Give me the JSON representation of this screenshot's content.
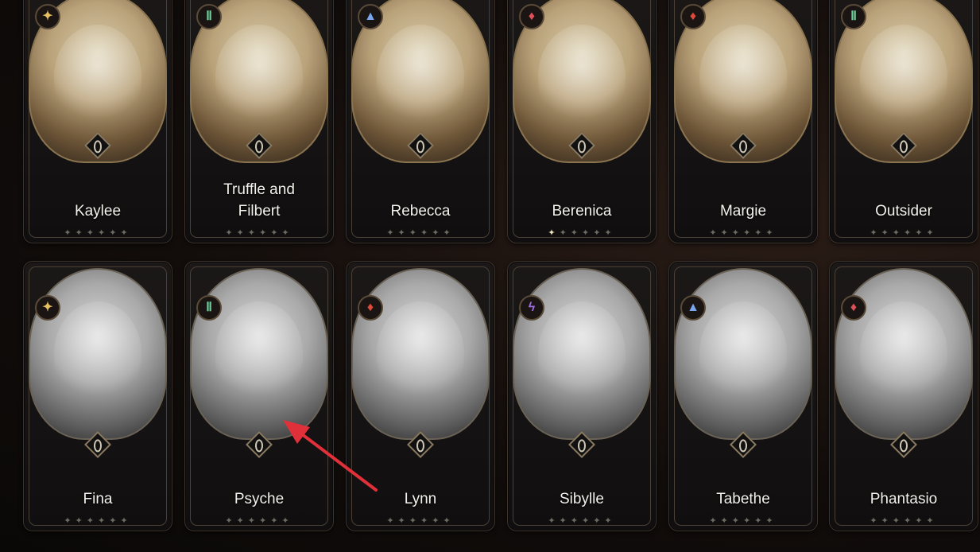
{
  "rows": [
    {
      "cards": [
        {
          "name": "Kaylee",
          "element": "light-icon",
          "glyph": "✦",
          "color": "#e8c060",
          "lit_stars": 0
        },
        {
          "name": "Truffle and\nFilbert",
          "element": "wind-icon",
          "glyph": "Ⅱ",
          "color": "#6fcf9a",
          "lit_stars": 0
        },
        {
          "name": "Rebecca",
          "element": "ice-icon",
          "glyph": "▲",
          "color": "#7aa6f0",
          "lit_stars": 0
        },
        {
          "name": "Berenica",
          "element": "fire-icon",
          "glyph": "♦",
          "color": "#e0505a",
          "lit_stars": 1
        },
        {
          "name": "Margie",
          "element": "fire-icon",
          "glyph": "♦",
          "color": "#e04a3a",
          "lit_stars": 0
        },
        {
          "name": "Outsider",
          "element": "wind-icon",
          "glyph": "Ⅱ",
          "color": "#6fcf9a",
          "lit_stars": 0
        }
      ]
    },
    {
      "cards": [
        {
          "name": "Fina",
          "element": "light-icon",
          "glyph": "✦",
          "color": "#e8c060",
          "lit_stars": 0
        },
        {
          "name": "Psyche",
          "element": "wind-icon",
          "glyph": "Ⅱ",
          "color": "#6fcf9a",
          "lit_stars": 0
        },
        {
          "name": "Lynn",
          "element": "fire-icon",
          "glyph": "♦",
          "color": "#e04a3a",
          "lit_stars": 0
        },
        {
          "name": "Sibylle",
          "element": "lightning-icon",
          "glyph": "ϟ",
          "color": "#a070e8",
          "lit_stars": 0
        },
        {
          "name": "Tabethe",
          "element": "ice-icon",
          "glyph": "▲",
          "color": "#7aa6f0",
          "lit_stars": 0
        },
        {
          "name": "Phantasio",
          "element": "fire-icon",
          "glyph": "♦",
          "color": "#e0505a",
          "lit_stars": 0
        }
      ]
    }
  ],
  "star_count": 6,
  "annotation": {
    "arrow_color": "#e0303a",
    "points_to": "Psyche"
  }
}
